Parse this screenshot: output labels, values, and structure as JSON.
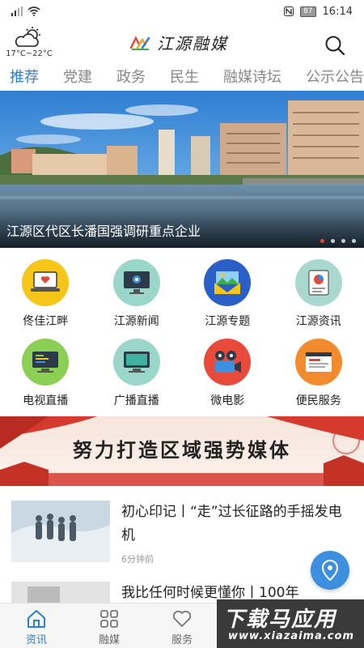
{
  "status_bar": {
    "battery": "87",
    "time": "16:14"
  },
  "header": {
    "weather_icon": "partly-cloudy-icon",
    "temperature": "17°C~22°C",
    "logo_text": "江源融媒",
    "search_icon": "search-icon"
  },
  "tabs": [
    {
      "label": "推荐",
      "active": true
    },
    {
      "label": "党建"
    },
    {
      "label": "政务"
    },
    {
      "label": "民生"
    },
    {
      "label": "融媒诗坛"
    },
    {
      "label": "公示公告"
    }
  ],
  "banner": {
    "caption": "江源区代区长潘国强调研重点企业"
  },
  "grid": [
    {
      "label": "佟佳江畔",
      "icon": "laptop-heart-icon",
      "color": "#f5c518"
    },
    {
      "label": "江源新闻",
      "icon": "monitor-gear-icon",
      "color": "#9ad6c9"
    },
    {
      "label": "江源专题",
      "icon": "image-envelope-icon",
      "color": "#2a5fc8"
    },
    {
      "label": "江源资讯",
      "icon": "document-chart-icon",
      "color": "#a8d8cf"
    },
    {
      "label": "电视直播",
      "icon": "tv-monitor-icon",
      "color": "#8bcf55"
    },
    {
      "label": "广播直播",
      "icon": "desktop-screen-icon",
      "color": "#9ad6c9"
    },
    {
      "label": "微电影",
      "icon": "film-camera-icon",
      "color": "#e84b3b"
    },
    {
      "label": "便民服务",
      "icon": "browser-window-icon",
      "color": "#f28a2e"
    }
  ],
  "promo": {
    "text": "努力打造区域强势媒体"
  },
  "news": [
    {
      "title": "初心印记丨“走”过长征路的手摇发电机",
      "time": "6分钟前"
    },
    {
      "title": "我比任何时候更懂你丨100年",
      "time": ""
    }
  ],
  "bottom_nav": [
    {
      "label": "资讯",
      "icon": "home-icon",
      "active": true
    },
    {
      "label": "融媒",
      "icon": "grid-icon"
    },
    {
      "label": "服务",
      "icon": "heart-icon"
    }
  ],
  "watermark": {
    "main": "下载马应用",
    "sub": "www.xiazaima.com"
  },
  "colors": {
    "accent": "#2a7fd0",
    "tab_inactive": "#888888",
    "dot_active": "#e24b3b"
  }
}
